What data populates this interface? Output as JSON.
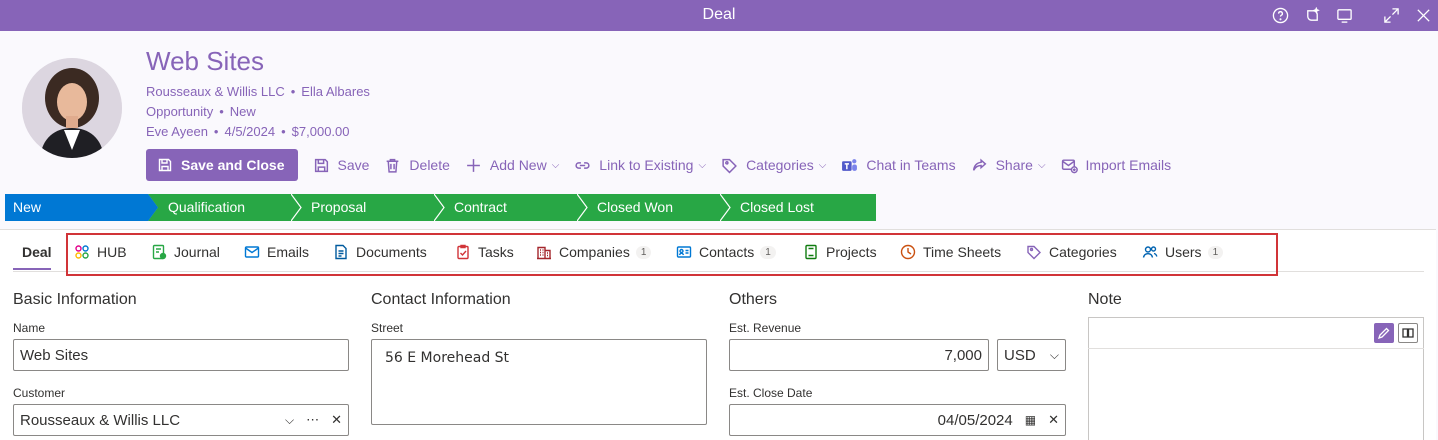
{
  "window": {
    "title": "Deal",
    "icons": [
      "help-icon",
      "copilot-icon",
      "screen-icon",
      "expand-icon",
      "close-icon"
    ]
  },
  "record": {
    "title": "Web Sites",
    "customer": "Rousseaux & Willis LLC",
    "contact": "Ella Albares",
    "type": "Opportunity",
    "status": "New",
    "owner": "Eve Ayeen",
    "date": "4/5/2024",
    "amount": "$7,000.00"
  },
  "commands": {
    "save_close": "Save and Close",
    "save": "Save",
    "delete": "Delete",
    "add_new": "Add New",
    "link_existing": "Link to Existing",
    "categories": "Categories",
    "chat_teams": "Chat in Teams",
    "share": "Share",
    "import_emails": "Import Emails"
  },
  "stages": [
    "New",
    "Qualification",
    "Proposal",
    "Contract",
    "Closed Won",
    "Closed Lost"
  ],
  "colors": {
    "accent": "#8764b8",
    "stage_active": "#0078d4",
    "stage_done": "#28a745",
    "highlight": "#d13438"
  },
  "tabs": [
    {
      "label": "Deal"
    },
    {
      "label": "HUB"
    },
    {
      "label": "Journal"
    },
    {
      "label": "Emails"
    },
    {
      "label": "Documents"
    },
    {
      "label": "Tasks"
    },
    {
      "label": "Companies",
      "count": "1"
    },
    {
      "label": "Contacts",
      "count": "1"
    },
    {
      "label": "Projects"
    },
    {
      "label": "Time Sheets"
    },
    {
      "label": "Categories"
    },
    {
      "label": "Users",
      "count": "1"
    }
  ],
  "sections": {
    "basic": {
      "title": "Basic Information",
      "name_label": "Name",
      "name_value": "Web Sites",
      "customer_label": "Customer",
      "customer_value": "Rousseaux & Willis LLC"
    },
    "contact": {
      "title": "Contact Information",
      "street_label": "Street",
      "street_value": "56 E Morehead St"
    },
    "others": {
      "title": "Others",
      "revenue_label": "Est. Revenue",
      "revenue_value": "7,000",
      "currency": "USD",
      "close_label": "Est. Close Date",
      "close_value": "04/05/2024"
    },
    "note": {
      "title": "Note"
    }
  }
}
